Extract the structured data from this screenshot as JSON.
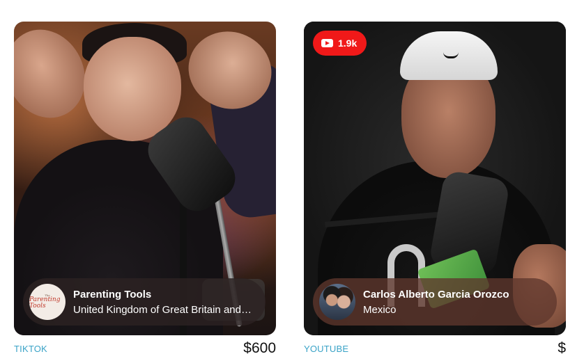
{
  "cards": [
    {
      "platform": "TIKTOK",
      "price": "$600",
      "creator_name": "Parenting Tools",
      "creator_location": "United Kingdom of Great Britain and Northern Ireland",
      "avatar_logo_small": "The",
      "avatar_logo_big": "Parenting Tools"
    },
    {
      "platform": "YOUTUBE",
      "price": "$",
      "creator_name": "Carlos Alberto Garcia Orozco",
      "creator_location": "Mexico",
      "badge": {
        "icon": "youtube-icon",
        "count": "1.9k"
      }
    }
  ],
  "colors": {
    "youtube_red": "#f01919",
    "platform_label": "#3aa3c7",
    "price_text": "#111111"
  }
}
